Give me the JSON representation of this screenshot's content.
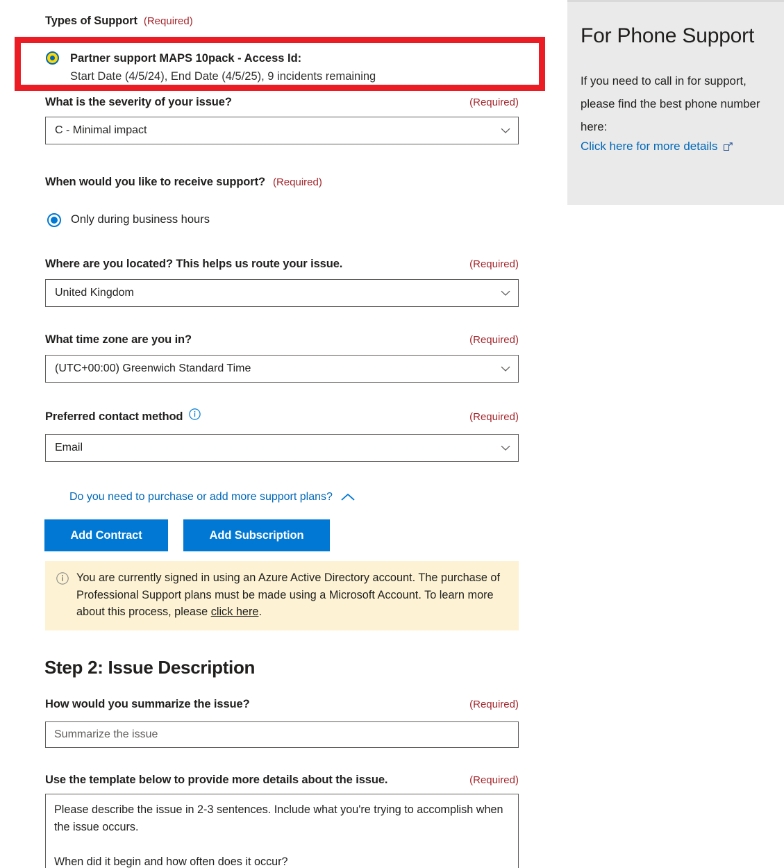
{
  "form": {
    "types_of_support": {
      "label": "Types of Support",
      "required": "(Required)",
      "selected_plan": {
        "title": "Partner support MAPS 10pack - Access Id:",
        "details": "Start Date (4/5/24), End Date (4/5/25), 9 incidents remaining"
      }
    },
    "severity": {
      "label": "What is the severity of your issue?",
      "required": "(Required)",
      "value": "C - Minimal impact"
    },
    "support_timing": {
      "label": "When would you like to receive support?",
      "required": "(Required)",
      "option": "Only during business hours"
    },
    "location": {
      "label": "Where are you located? This helps us route your issue.",
      "required": "(Required)",
      "value": "United Kingdom"
    },
    "timezone": {
      "label": "What time zone are you in?",
      "required": "(Required)",
      "value": "(UTC+00:00) Greenwich Standard Time"
    },
    "contact_method": {
      "label": "Preferred contact method",
      "required": "(Required)",
      "value": "Email",
      "info_icon": "info-icon"
    },
    "purchase_plans": {
      "link_text": "Do you need to purchase or add more support plans?",
      "chevron": "chevron-up-icon",
      "add_contract_label": "Add Contract",
      "add_subscription_label": "Add Subscription"
    },
    "notice": {
      "icon": "info-icon",
      "text_before_link": "You are currently signed in using an Azure Active Directory account. The purchase of Professional Support plans must be made using a Microsoft Account. To learn more about this process, please ",
      "link_text": "click here",
      "text_after_link": "."
    }
  },
  "step2": {
    "heading": "Step 2: Issue Description",
    "summary": {
      "label": "How would you summarize the issue?",
      "required": "(Required)",
      "value": "",
      "placeholder": "Summarize the issue"
    },
    "details": {
      "label": "Use the template below to provide more details about the issue.",
      "required": "(Required)",
      "value": "Please describe the issue in 2-3 sentences. Include what you're trying to accomplish when the issue occurs.\n\nWhen did it begin and how often does it occur?"
    }
  },
  "aside": {
    "title": "For Phone Support",
    "body": "If you need to call in for support, please find the best phone number here:",
    "link_text": "Click here for more details",
    "link_icon": "external-link-icon"
  },
  "colors": {
    "accent_blue": "#0078d4",
    "link_blue": "#0067b8",
    "required_red": "#a4262c",
    "annotation_red": "#ec1c24",
    "notice_yellow": "#fdf3d4",
    "aside_gray": "#eaeaea",
    "focus_yellow": "#ffd900"
  }
}
